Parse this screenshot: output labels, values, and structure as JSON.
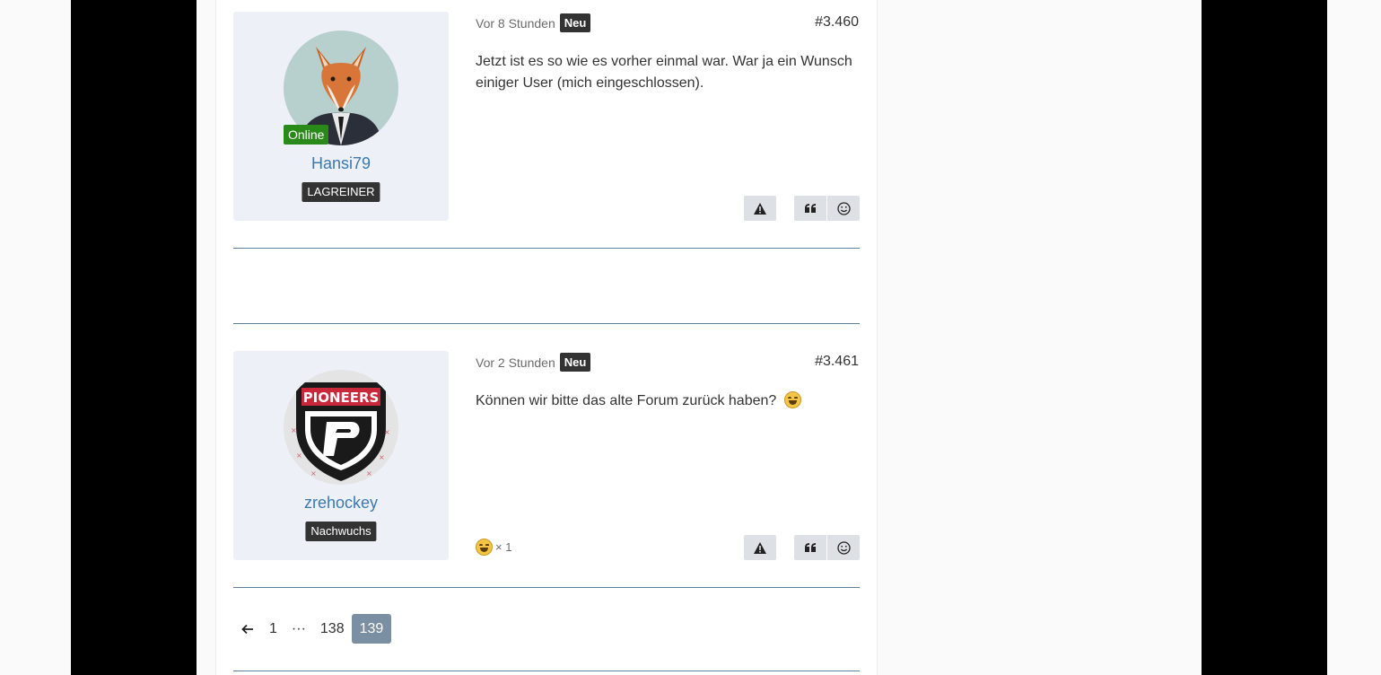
{
  "posts": [
    {
      "username": "Hansi79",
      "online_label": "Online",
      "rank": "LAGREINER",
      "time": "Vor 8 Stunden",
      "new_label": "Neu",
      "number": "#3.460",
      "text": "Jetzt ist es so wie es vorher einmal war. War ja ein Wunsch einiger User (mich eingeschlossen).",
      "avatar": "fox-in-suit-avatar"
    },
    {
      "username": "zrehockey",
      "rank": "Nachwuchs",
      "time": "Vor 2 Stunden",
      "new_label": "Neu",
      "number": "#3.461",
      "text": "Können wir bitte das alte Forum zurück haben?",
      "avatar": "pioneers-shield-avatar",
      "avatar_text": "PIONEERS",
      "reaction_count": "× 1"
    }
  ],
  "icons": {
    "report": "warning-icon",
    "quote": "quote-icon",
    "react": "smiley-icon",
    "prev": "arrow-left-icon"
  },
  "pagination": {
    "prev": "←",
    "pages": [
      "1",
      "···",
      "138",
      "139"
    ],
    "active": "139"
  },
  "colors": {
    "accent": "#3b79b0",
    "online": "#2a8a19",
    "active_page": "#7a8fa1",
    "user_box": "#edf0f7"
  }
}
